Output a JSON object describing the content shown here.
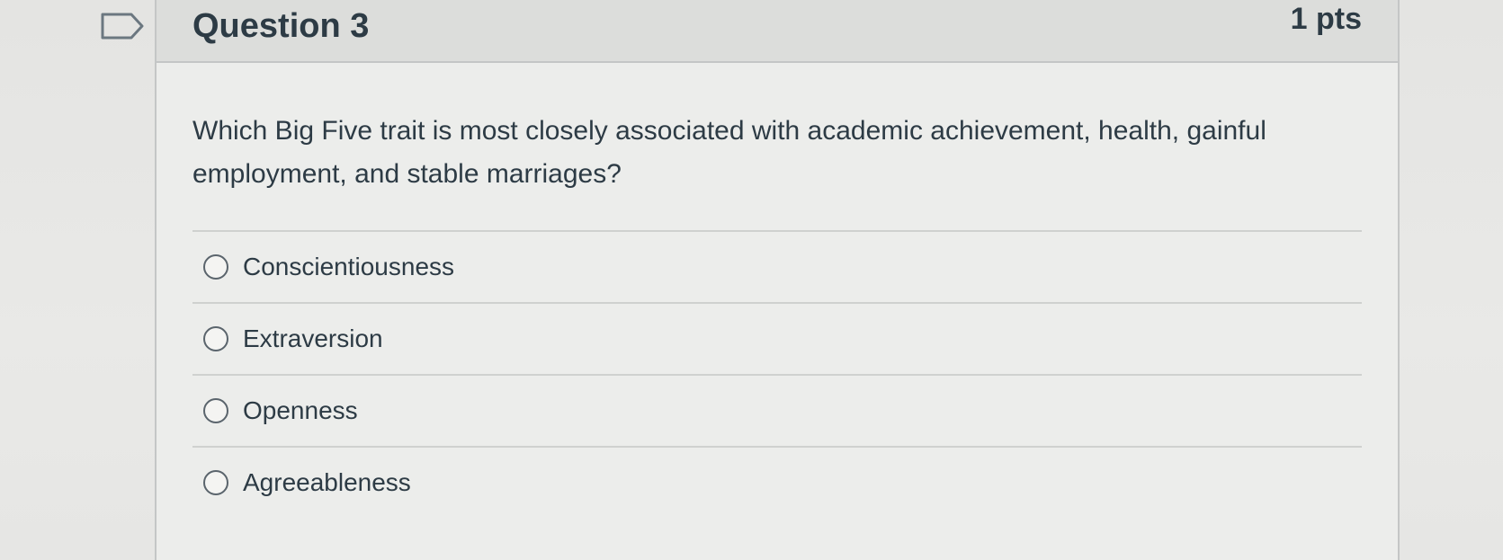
{
  "question": {
    "title": "Question 3",
    "points": "1 pts",
    "text": "Which Big Five trait is most closely associated with academic achievement, health, gainful employment, and stable marriages?",
    "answers": [
      {
        "label": "Conscientiousness",
        "selected": false
      },
      {
        "label": "Extraversion",
        "selected": false
      },
      {
        "label": "Openness",
        "selected": false
      },
      {
        "label": "Agreeableness",
        "selected": false
      }
    ]
  },
  "icons": {
    "flag": "flag-question-icon",
    "radio": "radio-button-icon"
  },
  "colors": {
    "text": "#2d3b45",
    "header_bg": "#dcdddb",
    "border": "#c4c6c6"
  }
}
